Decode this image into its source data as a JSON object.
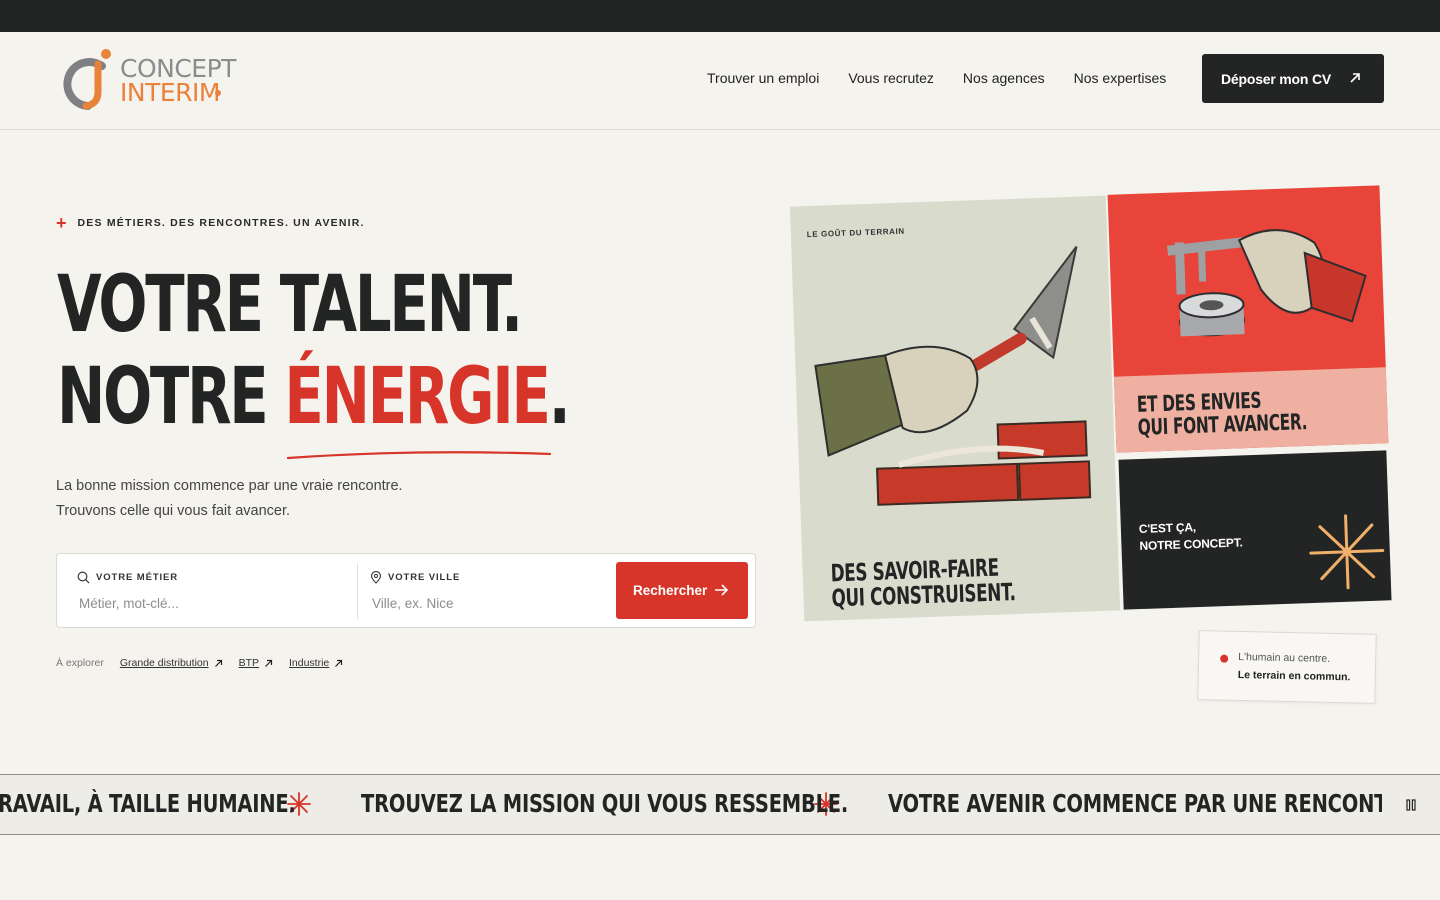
{
  "brand": {
    "line1": "CONCEPT",
    "line2": "INTERIM"
  },
  "nav": {
    "items": [
      "Trouver un emploi",
      "Vous recrutez",
      "Nos agences",
      "Nos expertises"
    ],
    "cta": "Déposer mon CV"
  },
  "hero": {
    "eyebrow": "DES MÉTIERS. DES RENCONTRES. UN AVENIR.",
    "title_line1": "VOTRE TALENT.",
    "title_line2_a": "NOTRE ",
    "title_line2_b": "ÉNERGIE",
    "title_line2_c": ".",
    "lead_1": "La bonne mission commence par une vraie rencontre.",
    "lead_2": "Trouvons celle qui vous fait avancer."
  },
  "search": {
    "job_label": "VOTRE MÉTIER",
    "job_placeholder": "Métier, mot-clé...",
    "city_label": "VOTRE VILLE",
    "city_placeholder": "Ville, ex. Nice",
    "button": "Rechercher"
  },
  "explore": {
    "prefix": "À explorer",
    "chips": [
      "Grande distribution",
      "BTP",
      "Industrie"
    ]
  },
  "cards": {
    "c1_tag": "LE GOÛT DU TERRAIN",
    "c1_title_1": "DES SAVOIR-FAIRE",
    "c1_title_2": "QUI CONSTRUISENT.",
    "c2_title_1": "ET DES ENVIES",
    "c2_title_2": "QUI FONT AVANCER.",
    "c3_line_1": "C'EST ÇA,",
    "c3_line_2": "NOTRE CONCEPT."
  },
  "note": {
    "line_1": "L'humain au centre.",
    "line_2": "Le terrain en commun."
  },
  "ticker": {
    "items": [
      "RAVAIL, À TAILLE HUMAINE.",
      "TROUVEZ LA MISSION QUI VOUS RESSEMBLE.",
      "VOTRE AVENIR COMMENCE PAR UNE RENCONTRE."
    ]
  },
  "colors": {
    "accent": "#d7342a",
    "dark": "#232524",
    "background": "#f5f3ee",
    "logo_orange": "#e9823a"
  }
}
